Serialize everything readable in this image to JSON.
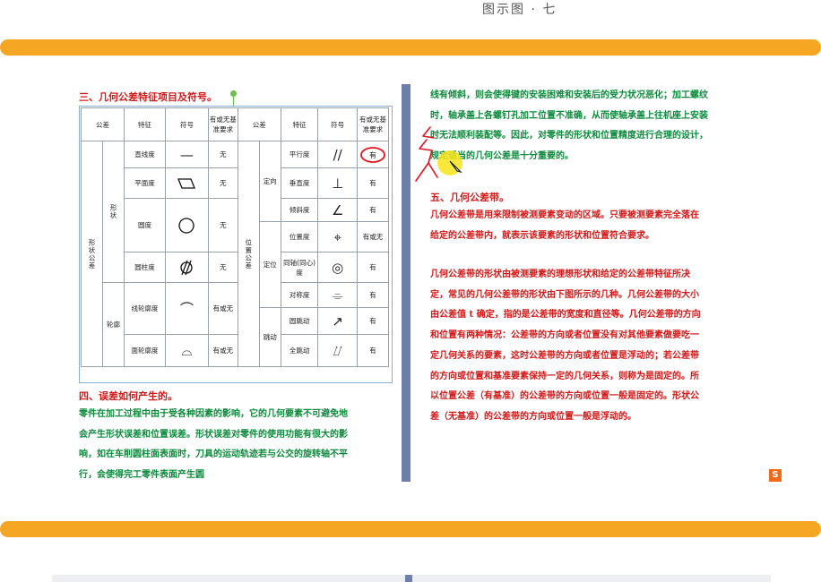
{
  "top_fragment": "图示图  ·  七",
  "colors": {
    "bar": "#f5a623",
    "heading": "#d21818",
    "body_green": "#0c8a3c",
    "gutter": "#6d7fa8"
  },
  "left_page": {
    "section3_title": "三、几何公差特征项目及符号。",
    "table": {
      "headers": [
        "公差",
        "特征",
        "符号",
        "有或无基准要求",
        "公差",
        "特征",
        "符号",
        "有或无基准要求"
      ],
      "group_form": "形状公差",
      "subgroup_shape": "形状",
      "subgroup_profile": "轮廓",
      "group_position": "位置公差",
      "sub_orientation": "定向",
      "sub_location": "定位",
      "sub_runout": "跳动",
      "left_rows": [
        {
          "feature": "直线度",
          "datum": "无"
        },
        {
          "feature": "平面度",
          "datum": "无"
        },
        {
          "feature": "圆度",
          "datum": "无"
        },
        {
          "feature": "圆柱度",
          "datum": "无"
        },
        {
          "feature": "线轮廓度",
          "datum": "有或无"
        },
        {
          "feature": "面轮廓度",
          "datum": "有或无"
        }
      ],
      "right_rows": [
        {
          "feature": "平行度",
          "datum": "有"
        },
        {
          "feature": "垂直度",
          "datum": "有"
        },
        {
          "feature": "倾斜度",
          "datum": "有"
        },
        {
          "feature": "位置度",
          "datum": "有或无"
        },
        {
          "feature": "同轴(同心)度",
          "datum": "有"
        },
        {
          "feature": "对称度",
          "datum": "有"
        },
        {
          "feature": "圆跳动",
          "datum": "有"
        },
        {
          "feature": "全跳动",
          "datum": "有"
        }
      ]
    },
    "section4_title": "四、误差如何产生的。",
    "section4_body": "零件在加工过程中由于受各种因素的影响，它的几何要素不可避免地会产生形状误差和位置误差。形状误差对零件的使用功能有很大的影响，如在车削圆柱面表面时，刀具的运动轨迹若与公交的旋转轴不平行，会使得完工零件表面产生圆"
  },
  "right_page": {
    "para1": "线有倾斜，则会使得键的安装困难和安装后的受力状况恶化；加工螺纹时，轴承盖上各螺钉孔加工位置不准确，从而使轴承盖上往机座上安装时无法顺利装配等。因此，对零件的形状和位置精度进行合理的设计，规定适当的几何公差是十分重要的。",
    "section5_title": "五、几何公差带。",
    "para2": "几何公差带是用来限制被测要素变动的区域。只要被测要素完全落在给定的公差带内，就表示该要素的形状和位置符合要求。",
    "para3": "几何公差带的形状由被测要素的理想形状和给定的公差带特征所决定，常见的几何公差带的形状由下图所示的几种。几何公差带的大小由公差值 t 确定，指的是公差带的宽度和直径等。几何公差带的方向和位置有两种情况：公差带的方向或者位置没有对其他要素做要吃一定几何关系的要素，这时公差带的方向或者位置是浮动的；若公差带的方向或位置和基准要素保持一定的几何关系，则称为是固定的。所以位置公差（有基准）的公差带的方向或位置一般是固定的。形状公差（无基准）的公差带的方向或位置一般是浮动的。"
  },
  "logo_text": "S"
}
